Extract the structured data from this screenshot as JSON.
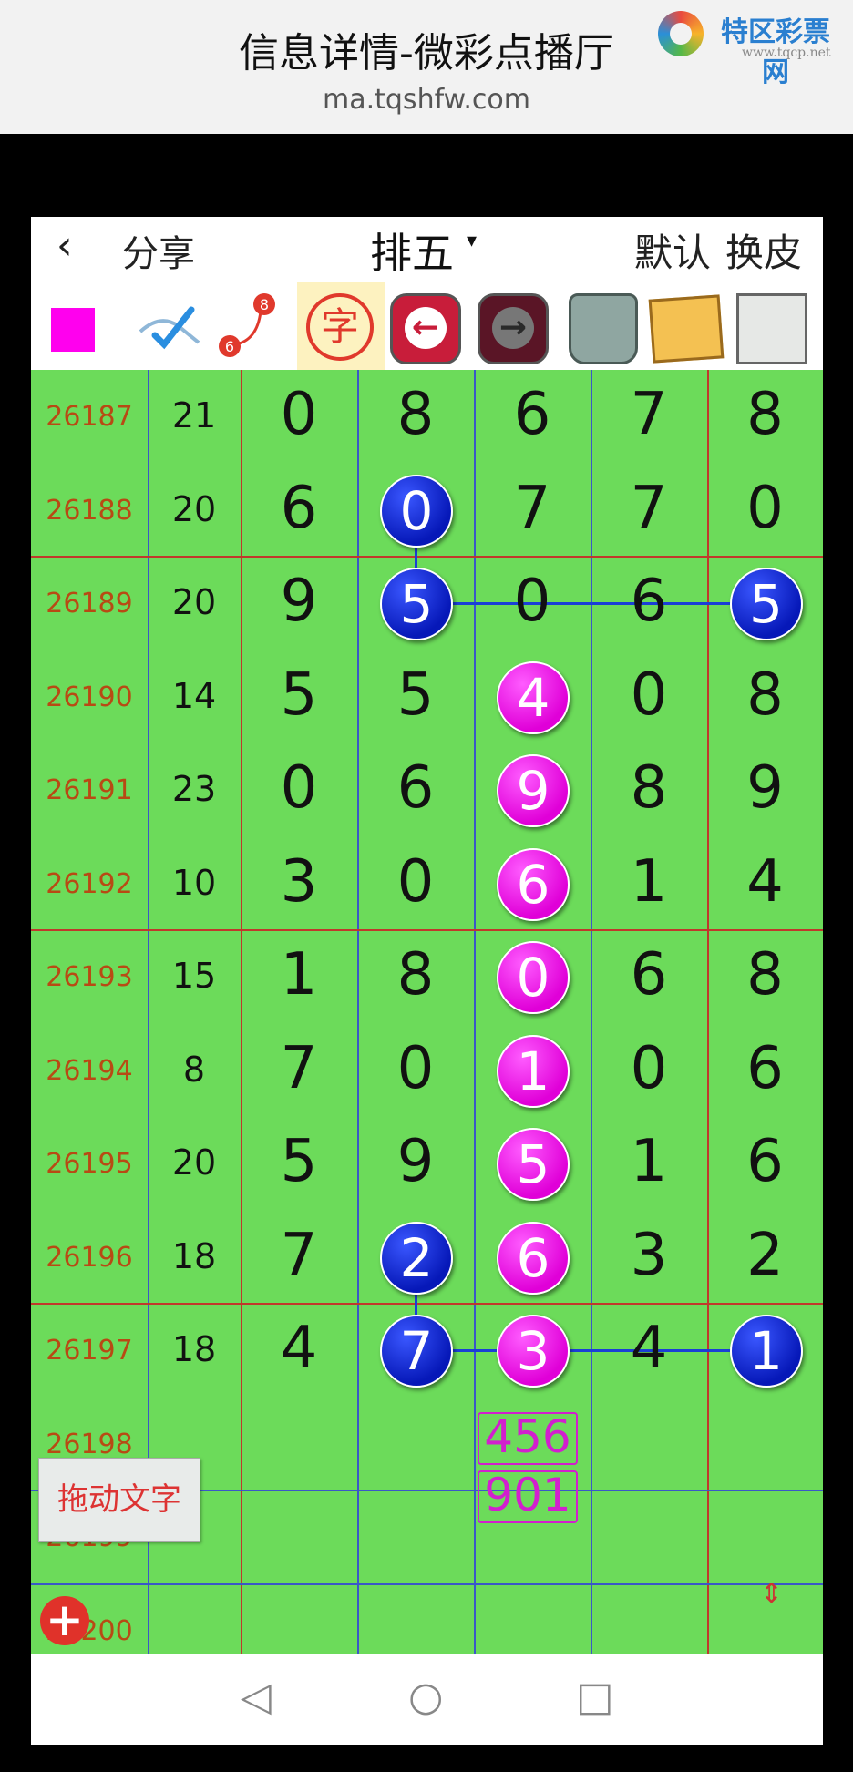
{
  "header": {
    "title": "信息详情-微彩点播厅",
    "url": "ma.tqshfw.com",
    "logo_name": "特区彩票网",
    "logo_site": "www.tqcp.net"
  },
  "appbar": {
    "back": "‹",
    "share": "分享",
    "lottery": "排五",
    "caret": "▾",
    "default": "默认",
    "skin": "换皮"
  },
  "toolbar": {
    "char_label": "字",
    "prev_icon": "arrow-left-icon",
    "next_icon": "arrow-right-icon",
    "badge_top": "8",
    "badge_bottom": "6"
  },
  "rows": [
    {
      "period": "26187",
      "sum": "21",
      "digits": [
        "0",
        "8",
        "6",
        "7",
        "8"
      ]
    },
    {
      "period": "26188",
      "sum": "20",
      "digits": [
        "6",
        "0",
        "7",
        "7",
        "0"
      ]
    },
    {
      "period": "26189",
      "sum": "20",
      "digits": [
        "9",
        "5",
        "0",
        "6",
        "5"
      ]
    },
    {
      "period": "26190",
      "sum": "14",
      "digits": [
        "5",
        "5",
        "4",
        "0",
        "8"
      ]
    },
    {
      "period": "26191",
      "sum": "23",
      "digits": [
        "0",
        "6",
        "9",
        "8",
        "9"
      ]
    },
    {
      "period": "26192",
      "sum": "10",
      "digits": [
        "3",
        "0",
        "6",
        "1",
        "4"
      ]
    },
    {
      "period": "26193",
      "sum": "15",
      "digits": [
        "1",
        "8",
        "0",
        "6",
        "8"
      ]
    },
    {
      "period": "26194",
      "sum": "8",
      "digits": [
        "7",
        "0",
        "1",
        "0",
        "6"
      ]
    },
    {
      "period": "26195",
      "sum": "20",
      "digits": [
        "5",
        "9",
        "5",
        "1",
        "6"
      ]
    },
    {
      "period": "26196",
      "sum": "18",
      "digits": [
        "7",
        "2",
        "6",
        "3",
        "2"
      ]
    },
    {
      "period": "26197",
      "sum": "18",
      "digits": [
        "4",
        "7",
        "3",
        "4",
        "1"
      ]
    },
    {
      "period": "26198",
      "sum": "",
      "digits": [
        "",
        "",
        "",
        "",
        ""
      ]
    },
    {
      "period": "26199",
      "sum": "",
      "digits": [
        "",
        "",
        "",
        "",
        ""
      ]
    },
    {
      "period": "26200",
      "sum": "",
      "digits": [
        "",
        "",
        "",
        "",
        ""
      ]
    }
  ],
  "highlights": {
    "blue": [
      [
        1,
        1
      ],
      [
        2,
        1
      ],
      [
        2,
        4
      ],
      [
        9,
        1
      ],
      [
        10,
        1
      ],
      [
        10,
        4
      ]
    ],
    "pink": [
      [
        3,
        2
      ],
      [
        4,
        2
      ],
      [
        5,
        2
      ],
      [
        6,
        2
      ],
      [
        7,
        2
      ],
      [
        8,
        2
      ],
      [
        9,
        2
      ],
      [
        10,
        2
      ]
    ]
  },
  "prediction": [
    "456",
    "901"
  ],
  "drag_label": "拖动文字",
  "add_label": "+",
  "resize_label": "⇕",
  "sysnav": {
    "back": "◁",
    "home": "○",
    "recent": "□"
  },
  "colors": {
    "grid_bg": "#6cdb5a",
    "period_text": "#b84a14",
    "blue_ball": "#0618b8",
    "pink_ball": "#e000d8",
    "separator_red": "#c0392b",
    "separator_blue": "#3a58c8"
  }
}
